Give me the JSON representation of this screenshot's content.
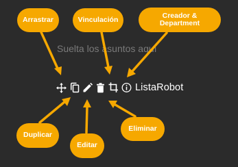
{
  "board": {
    "drop_hint": "Suelta los asuntos aquí"
  },
  "card": {
    "title": "ListaRobot",
    "toolbar_icons": [
      "move-icon",
      "copy-icon",
      "pencil-icon",
      "trash-icon",
      "crop-icon",
      "info-icon"
    ]
  },
  "callouts": {
    "arrastrar": "Arrastrar",
    "vinculacion": "Vinculación",
    "creador_line1": "Creador &",
    "creador_line2": "Department",
    "duplicar": "Duplicar",
    "editar": "Editar",
    "eliminar": "Eliminar"
  },
  "colors": {
    "background": "#2b2b2b",
    "callout": "#f6a800",
    "callout_text": "#ffffff",
    "hint_text": "#7a7a7a",
    "card_text": "#ffffff"
  }
}
